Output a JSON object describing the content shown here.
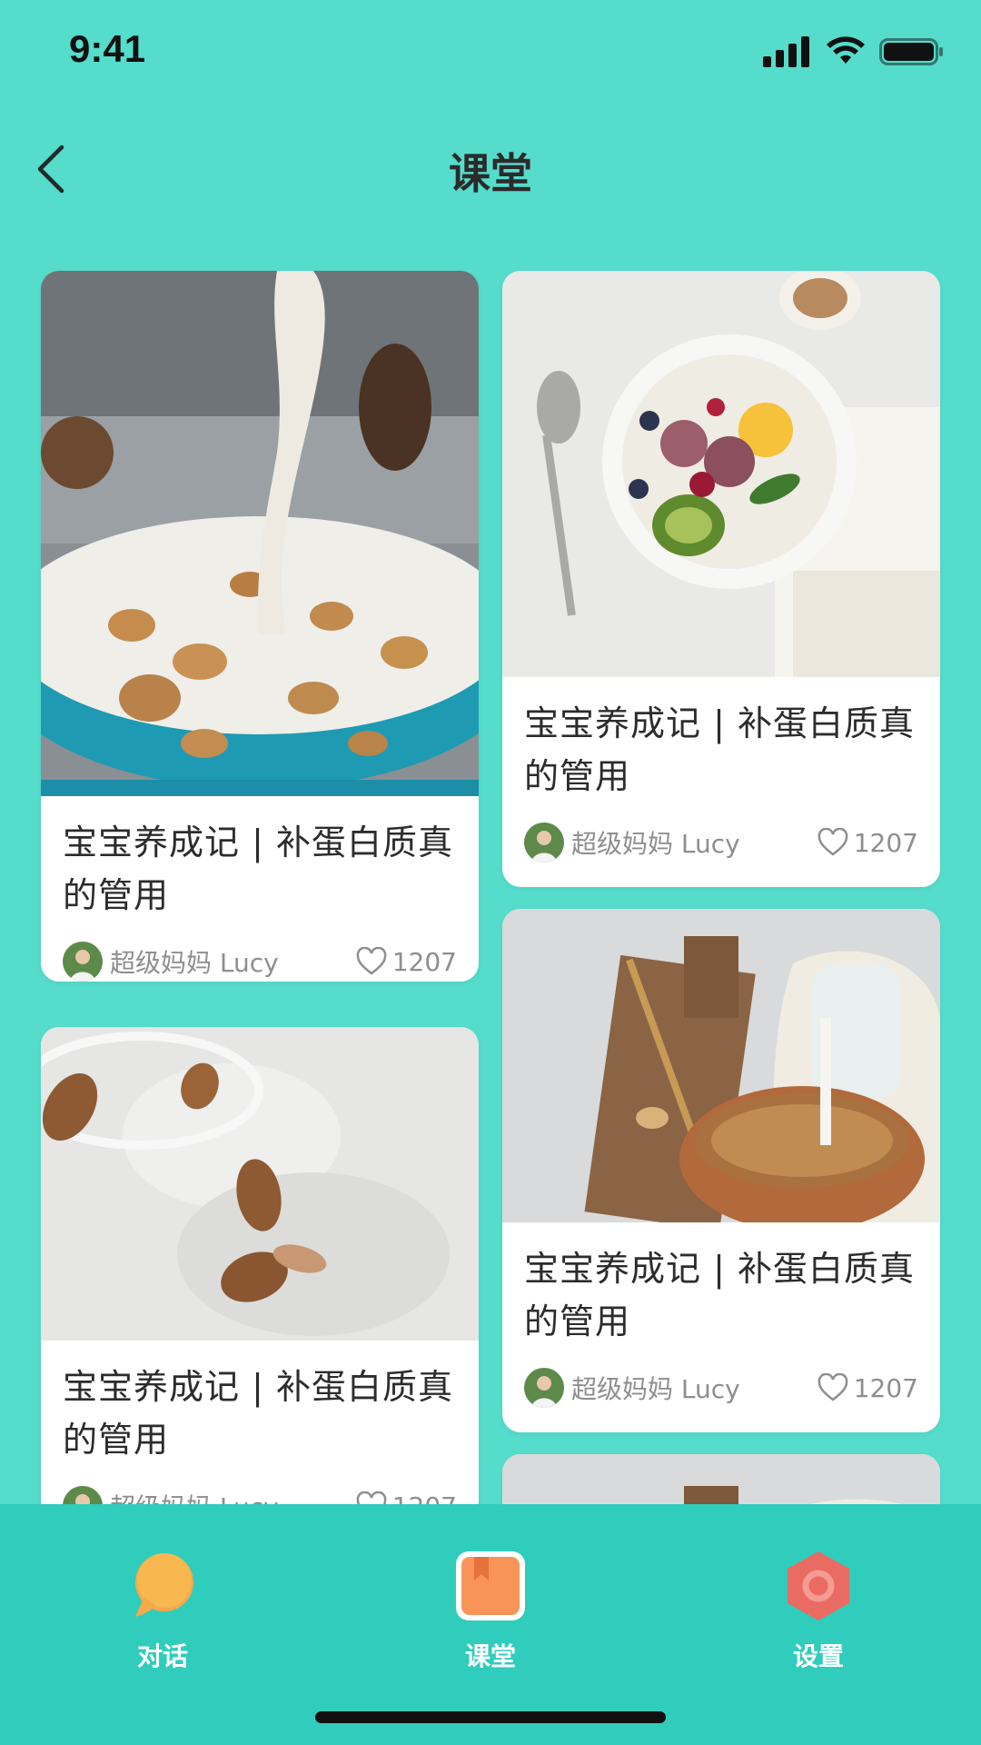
{
  "status": {
    "time": "9:41"
  },
  "nav": {
    "title": "课堂"
  },
  "cards": [
    {
      "title": "宝宝养成记 | 补蛋白质真的管用",
      "author": "超级妈妈 Lucy",
      "likes": "1207",
      "image": "cereal-milk-photo"
    },
    {
      "title": "宝宝养成记 | 补蛋白质真的管用",
      "author": "超级妈妈 Lucy",
      "likes": "1207",
      "image": "fruit-bowl-photo"
    },
    {
      "title": "宝宝养成记 | 补蛋白质真的管用",
      "author": "超级妈妈 Lucy",
      "likes": "1207",
      "image": "almond-milk-photo"
    },
    {
      "title": "宝宝养成记 | 补蛋白质真的管用",
      "author": "超级妈妈 Lucy",
      "likes": "1207",
      "image": "granola-milk-photo"
    }
  ],
  "tabbar": {
    "items": [
      {
        "label": "对话",
        "icon": "chat-bubble-icon",
        "active": false
      },
      {
        "label": "课堂",
        "icon": "book-icon",
        "active": true
      },
      {
        "label": "设置",
        "icon": "hexagon-gear-icon",
        "active": false
      }
    ]
  },
  "colors": {
    "background": "#55dccb",
    "tabbar": "#30ccbc",
    "card": "#ffffff",
    "title_text": "#2c2c2c",
    "meta_text": "#8e8e8e"
  }
}
